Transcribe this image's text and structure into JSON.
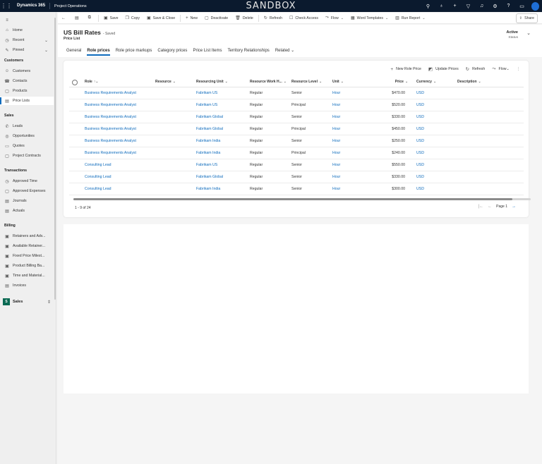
{
  "topnav": {
    "brand": "Dynamics 365",
    "app": "Project Operations",
    "environment": "SANDBOX",
    "icons": [
      "search-icon",
      "lightbulb-icon",
      "plus-icon",
      "filter-icon",
      "bell-icon",
      "settings-icon",
      "help-icon",
      "chat-icon"
    ]
  },
  "sidebar": {
    "top": [
      {
        "label": "Home",
        "icon": "home-icon"
      },
      {
        "label": "Recent",
        "icon": "clock-icon",
        "chevron": true
      },
      {
        "label": "Pinned",
        "icon": "pin-icon",
        "chevron": true
      }
    ],
    "groups": [
      {
        "title": "Customers",
        "items": [
          "Customers",
          "Contacts",
          "Products",
          "Price Lists"
        ]
      },
      {
        "title": "Sales",
        "items": [
          "Leads",
          "Opportunities",
          "Quotes",
          "Project Contracts"
        ]
      },
      {
        "title": "Transactions",
        "items": [
          "Approved Time",
          "Approved Expenses",
          "Journals",
          "Actuals"
        ]
      },
      {
        "title": "Billing",
        "items": [
          "Retainers and Adv...",
          "Available Retainer...",
          "Fixed Price Milest...",
          "Product Billing Ba...",
          "Time and Material...",
          "Invoices"
        ]
      }
    ],
    "active_item": "Price Lists",
    "area": {
      "badge": "S",
      "label": "Sales"
    }
  },
  "commandbar": {
    "items": [
      {
        "label": "Save",
        "icon": "save-icon"
      },
      {
        "label": "Copy",
        "icon": "copy-icon"
      },
      {
        "label": "Save & Close",
        "icon": "save-close-icon"
      },
      {
        "label": "New",
        "icon": "plus-icon"
      },
      {
        "label": "Deactivate",
        "icon": "deactivate-icon"
      },
      {
        "label": "Delete",
        "icon": "trash-icon"
      },
      {
        "label": "Refresh",
        "icon": "refresh-icon"
      },
      {
        "label": "Check Access",
        "icon": "check-access-icon"
      },
      {
        "label": "Flow",
        "icon": "flow-icon",
        "dropdown": true
      },
      {
        "label": "Word Templates",
        "icon": "word-icon",
        "dropdown": true
      },
      {
        "label": "Run Report",
        "icon": "report-icon",
        "dropdown": true
      }
    ],
    "share": "Share"
  },
  "header": {
    "title": "US Bill Rates",
    "saved": "- Saved",
    "entity": "Price List",
    "status_value": "Active",
    "status_label": "Status"
  },
  "tabs": [
    "General",
    "Role prices",
    "Role price markups",
    "Category prices",
    "Price List Items",
    "Territory Relationships",
    "Related"
  ],
  "active_tab": "Role prices",
  "grid": {
    "commands": [
      {
        "label": "New Role Price",
        "icon": "plus-icon"
      },
      {
        "label": "Update Prices",
        "icon": "update-icon"
      },
      {
        "label": "Refresh",
        "icon": "refresh-icon"
      },
      {
        "label": "Flow",
        "icon": "flow-icon"
      }
    ],
    "columns": [
      "Role",
      "Resource",
      "Resourcing Unit",
      "Resource Work H...",
      "Resource Level",
      "Unit",
      "Price",
      "Currency",
      "Description"
    ],
    "rows": [
      [
        "Business Requirements Analyst",
        "",
        "Fabrikam US",
        "Regular",
        "Senior",
        "Hour",
        "$470.00",
        "USD",
        ""
      ],
      [
        "Business Requirements Analyst",
        "",
        "Fabrikam US",
        "Regular",
        "Principal",
        "Hour",
        "$520.00",
        "USD",
        ""
      ],
      [
        "Business Requirements Analyst",
        "",
        "Fabrikam Global",
        "Regular",
        "Senior",
        "Hour",
        "$330.00",
        "USD",
        ""
      ],
      [
        "Business Requirements Analyst",
        "",
        "Fabrikam Global",
        "Regular",
        "Principal",
        "Hour",
        "$450.00",
        "USD",
        ""
      ],
      [
        "Business Requirements Analyst",
        "",
        "Fabrikam India",
        "Regular",
        "Senior",
        "Hour",
        "$250.00",
        "USD",
        ""
      ],
      [
        "Business Requirements Analyst",
        "",
        "Fabrikam India",
        "Regular",
        "Principal",
        "Hour",
        "$240.00",
        "USD",
        ""
      ],
      [
        "Consulting Lead",
        "",
        "Fabrikam US",
        "Regular",
        "Senior",
        "Hour",
        "$550.00",
        "USD",
        ""
      ],
      [
        "Consulting Lead",
        "",
        "Fabrikam Global",
        "Regular",
        "Senior",
        "Hour",
        "$330.00",
        "USD",
        ""
      ],
      [
        "Consulting Lead",
        "",
        "Fabrikam India",
        "Regular",
        "Senior",
        "Hour",
        "$300.00",
        "USD",
        ""
      ]
    ],
    "record_count": "1 - 9 of 24",
    "page": "Page 1"
  },
  "colors": {
    "accent": "#0f6cbd",
    "topnav": "#0b1a2e",
    "area_badge": "#0b6a53"
  }
}
